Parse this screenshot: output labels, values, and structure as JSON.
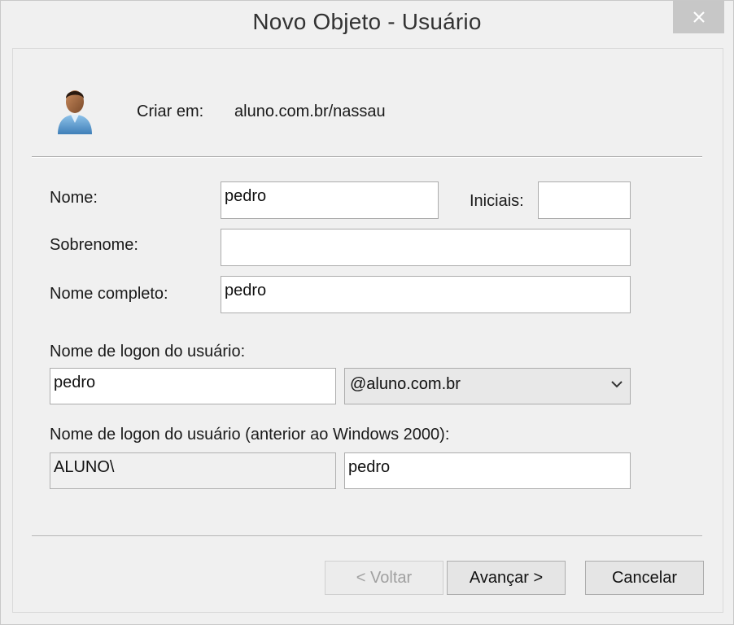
{
  "window": {
    "title": "Novo Objeto - Usuário",
    "close_icon": "close-icon"
  },
  "header": {
    "icon": "user-icon",
    "create_in_label": "Criar em:",
    "create_in_value": "aluno.com.br/nassau"
  },
  "form": {
    "first_name_label": "Nome:",
    "first_name_value": "pedro",
    "initials_label": "Iniciais:",
    "initials_value": "",
    "last_name_label": "Sobrenome:",
    "last_name_value": "",
    "full_name_label": "Nome completo:",
    "full_name_value": "pedro",
    "logon_label": "Nome de logon do usuário:",
    "logon_value": "pedro",
    "logon_suffix": "@aluno.com.br",
    "pre2000_label": "Nome de logon do usuário (anterior ao Windows 2000):",
    "pre2000_domain": "ALUNO\\",
    "pre2000_value": "pedro"
  },
  "buttons": {
    "back_label": "< Voltar",
    "next_label": "Avançar >",
    "cancel_label": "Cancelar"
  }
}
